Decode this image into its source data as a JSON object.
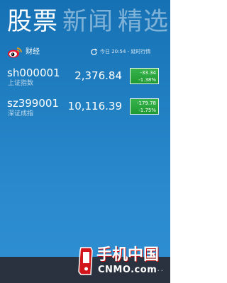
{
  "header": {
    "tabs": [
      {
        "label": "股票",
        "active": true
      },
      {
        "label": "新闻",
        "active": false
      },
      {
        "label": "精选",
        "active": false
      }
    ]
  },
  "source": {
    "logo_icon": "weibo-eye-icon",
    "name": "财经",
    "refresh_icon": "refresh-icon",
    "update_time": "今日 20:54 - 延时行情"
  },
  "stocks": [
    {
      "code": "sh000001",
      "name": "上证指数",
      "price": "2,376.84",
      "change": "-33.34",
      "change_pct": "-1.38%"
    },
    {
      "code": "sz399001",
      "name": "深证成指",
      "price": "10,116.39",
      "change": "-179.78",
      "change_pct": "-1.75%"
    }
  ],
  "colors": {
    "background": "#2080c2",
    "change_box": "#28a83c",
    "app_bar": "#2a323f",
    "watermark_red": "#d0151b"
  },
  "watermark": {
    "title": "手机中国",
    "domain": "CNMO.com"
  },
  "app_bar": {
    "more_label": "..."
  }
}
